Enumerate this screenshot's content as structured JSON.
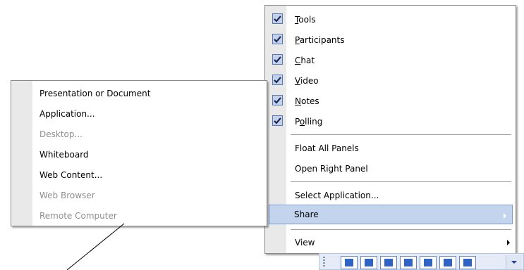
{
  "main_menu": {
    "items": [
      {
        "label": "Tools",
        "mnemonic": "T",
        "checked": true
      },
      {
        "label": "Participants",
        "mnemonic": "P",
        "checked": true
      },
      {
        "label": "Chat",
        "mnemonic": "C",
        "checked": true
      },
      {
        "label": "Video",
        "mnemonic": "V",
        "checked": true
      },
      {
        "label": "Notes",
        "mnemonic": "N",
        "checked": true
      },
      {
        "label": "Polling",
        "mnemonic": "o",
        "checked": true
      },
      {
        "label": "Float All Panels"
      },
      {
        "label": "Open Right Panel"
      },
      {
        "label": "Select Application..."
      },
      {
        "label": "Share",
        "highlighted": true,
        "has_submenu": true
      },
      {
        "label": "View",
        "has_submenu": true
      }
    ]
  },
  "share_submenu": {
    "items": [
      {
        "label": "Presentation or Document",
        "enabled": true
      },
      {
        "label": "Application...",
        "enabled": true
      },
      {
        "label": "Desktop...",
        "enabled": false
      },
      {
        "label": "Whiteboard",
        "enabled": true
      },
      {
        "label": "Web Content...",
        "enabled": true
      },
      {
        "label": "Web Browser",
        "enabled": false
      },
      {
        "label": "Remote Computer",
        "enabled": false
      }
    ]
  },
  "colors": {
    "gutter": "#e9e9e9",
    "highlight": "#c3d4ef",
    "disabled_text": "#8f8f8f",
    "check_box": "#c3d2ea"
  },
  "icons": [
    "checkmark-icon",
    "submenu-arrow-icon"
  ]
}
